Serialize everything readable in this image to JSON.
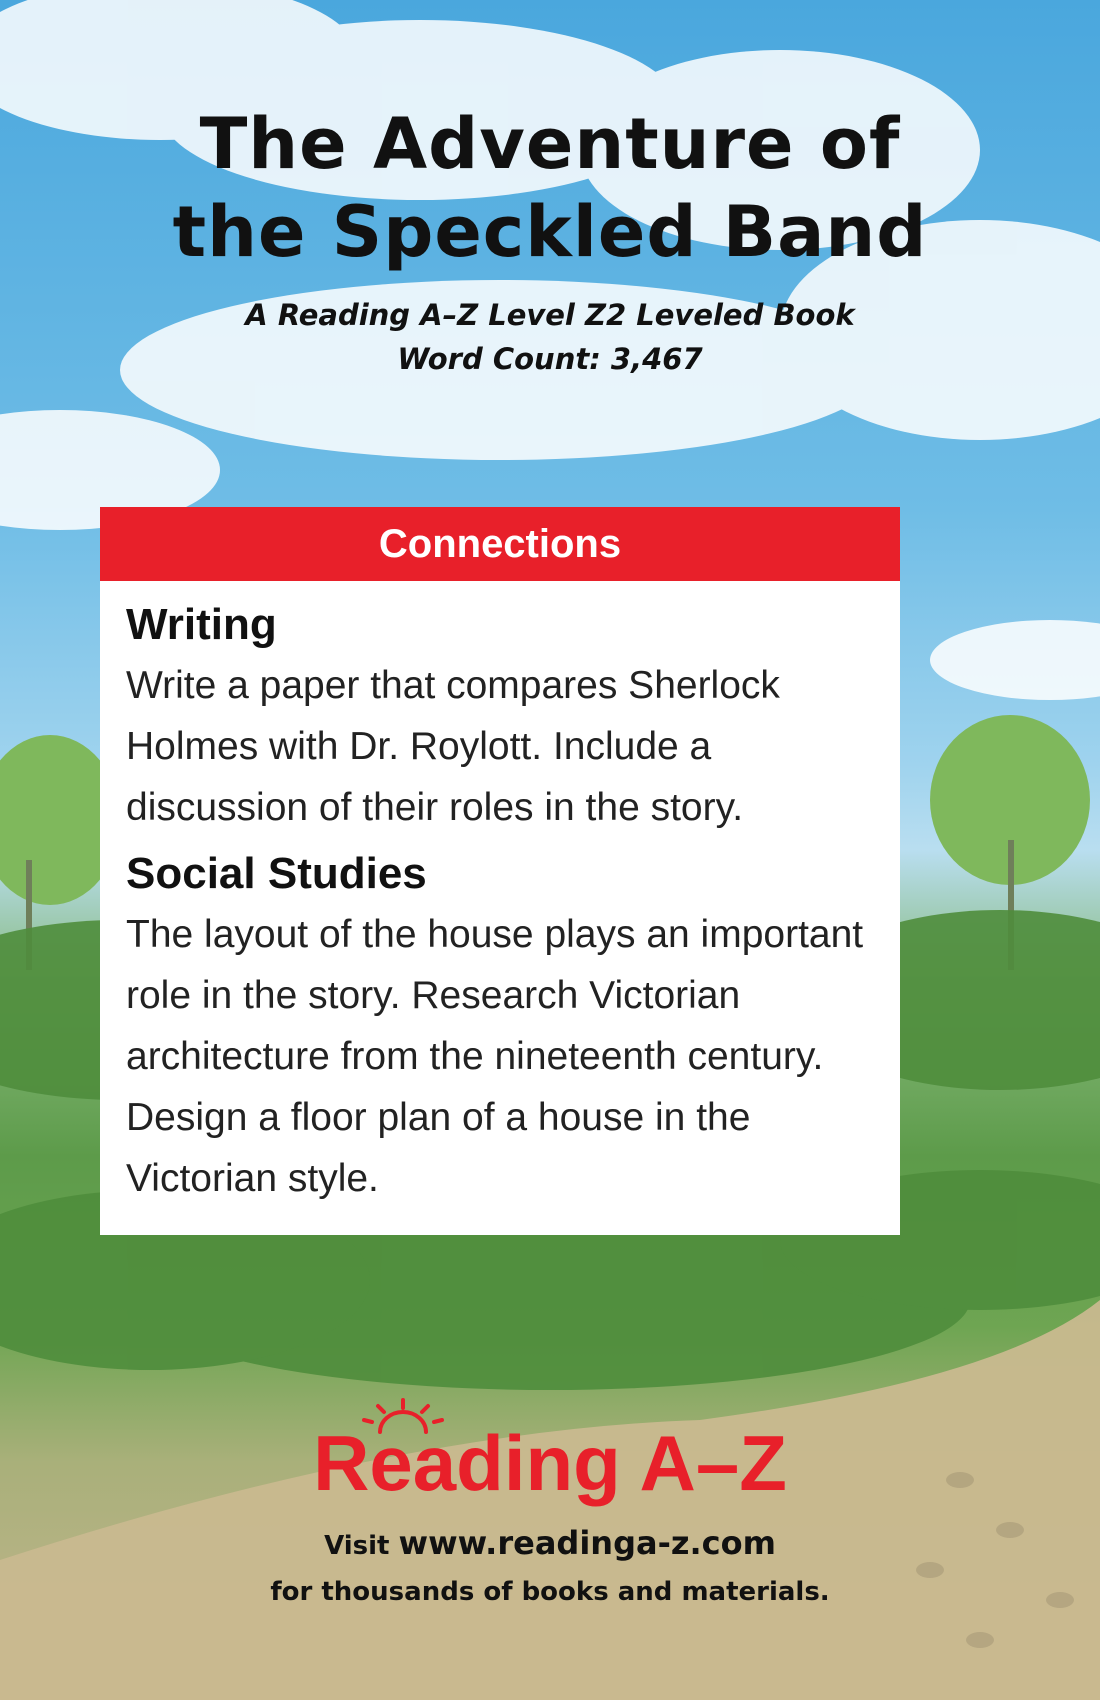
{
  "book": {
    "title_line1": "The Adventure of",
    "title_line2": "the Speckled Band",
    "subtitle": "A Reading A–Z Level Z2 Leveled Book",
    "word_count": "Word Count: 3,467"
  },
  "connections": {
    "header": "Connections",
    "sections": [
      {
        "title": "Writing",
        "text": "Write a paper that compares Sherlock Holmes with Dr. Roylott. Include a discussion of their roles in the story."
      },
      {
        "title": "Social Studies",
        "text": "The layout of the house plays an important role in the story. Research Victorian architecture from the nineteenth century. Design a floor plan of a house in the Victorian style."
      }
    ]
  },
  "footer": {
    "logo_text": "Reading A–Z",
    "visit_word": "Visit",
    "url": "www.readinga-z.com",
    "tagline": "for thousands of books and materials."
  },
  "colors": {
    "accent_red": "#e8202a",
    "sky": "#4aa7dd",
    "grass": "#5d9b4a"
  }
}
